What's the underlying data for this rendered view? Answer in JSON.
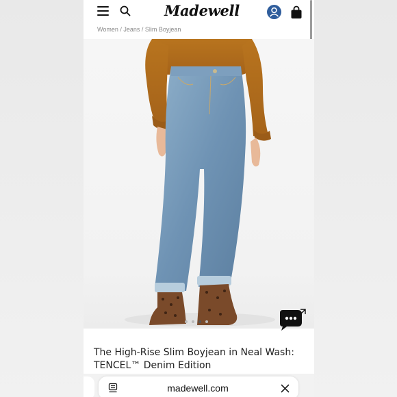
{
  "header": {
    "logo_text": "Madewell",
    "menu_icon": "hamburger-menu-icon",
    "search_icon": "search-icon",
    "account_icon": "account-icon",
    "bag_icon": "shopping-bag-icon",
    "account_color": "#2f5d9c"
  },
  "breadcrumb": {
    "text": "Women / Jeans / Slim Boyjean"
  },
  "product": {
    "title": "The High-Rise Slim Boyjean in Neal Wash: TENCEL™ Denim Edition",
    "image_icon": "product-photo"
  },
  "chat": {
    "icon": "chat-bubble-icon"
  },
  "browser": {
    "url": "madewell.com",
    "reader_icon": "reader-mode-icon",
    "close_icon": "close-icon"
  }
}
